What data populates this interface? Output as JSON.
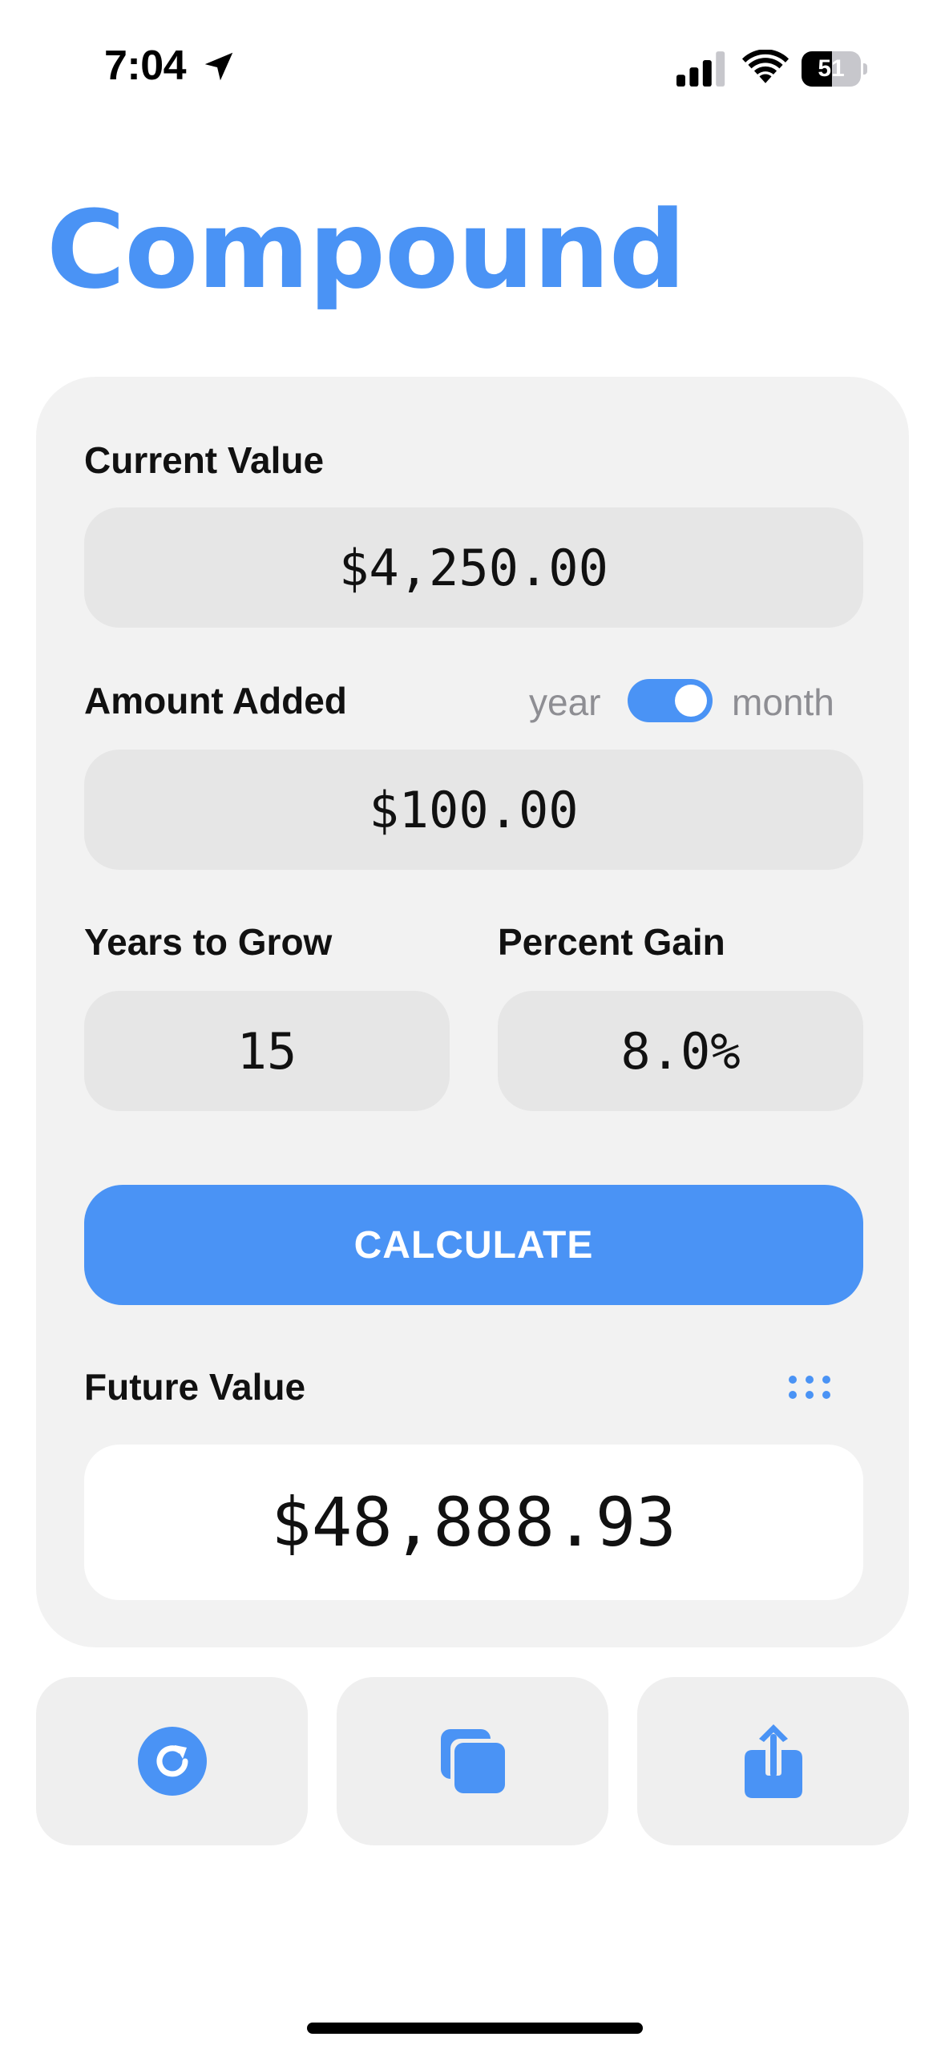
{
  "status_bar": {
    "time": "7:04",
    "battery_level": "51",
    "battery_fraction": 0.51,
    "icons": [
      "location-arrow-icon",
      "cellular-signal-icon",
      "wifi-icon",
      "battery-icon"
    ]
  },
  "app": {
    "title": "Compound"
  },
  "form": {
    "current_value": {
      "label": "Current Value",
      "value": "$4,250.00"
    },
    "amount_added": {
      "label": "Amount Added",
      "value": "$100.00",
      "frequency_left": "year",
      "frequency_right": "month",
      "frequency_selected": "month"
    },
    "years_to_grow": {
      "label": "Years to Grow",
      "value": "15"
    },
    "percent_gain": {
      "label": "Percent Gain",
      "value": "8.0%"
    },
    "calculate_label": "CALCULATE"
  },
  "result": {
    "label": "Future Value",
    "value": "$48,888.93",
    "menu_icon": "grid-dots-icon"
  },
  "actions": [
    {
      "name": "reset",
      "icon": "refresh-icon"
    },
    {
      "name": "copy",
      "icon": "copy-icon"
    },
    {
      "name": "share",
      "icon": "share-icon"
    }
  ],
  "colors": {
    "accent": "#4a93f5",
    "card_background": "#f2f2f2",
    "field_background": "#e6e6e6",
    "secondary_text": "#8e8e93"
  }
}
